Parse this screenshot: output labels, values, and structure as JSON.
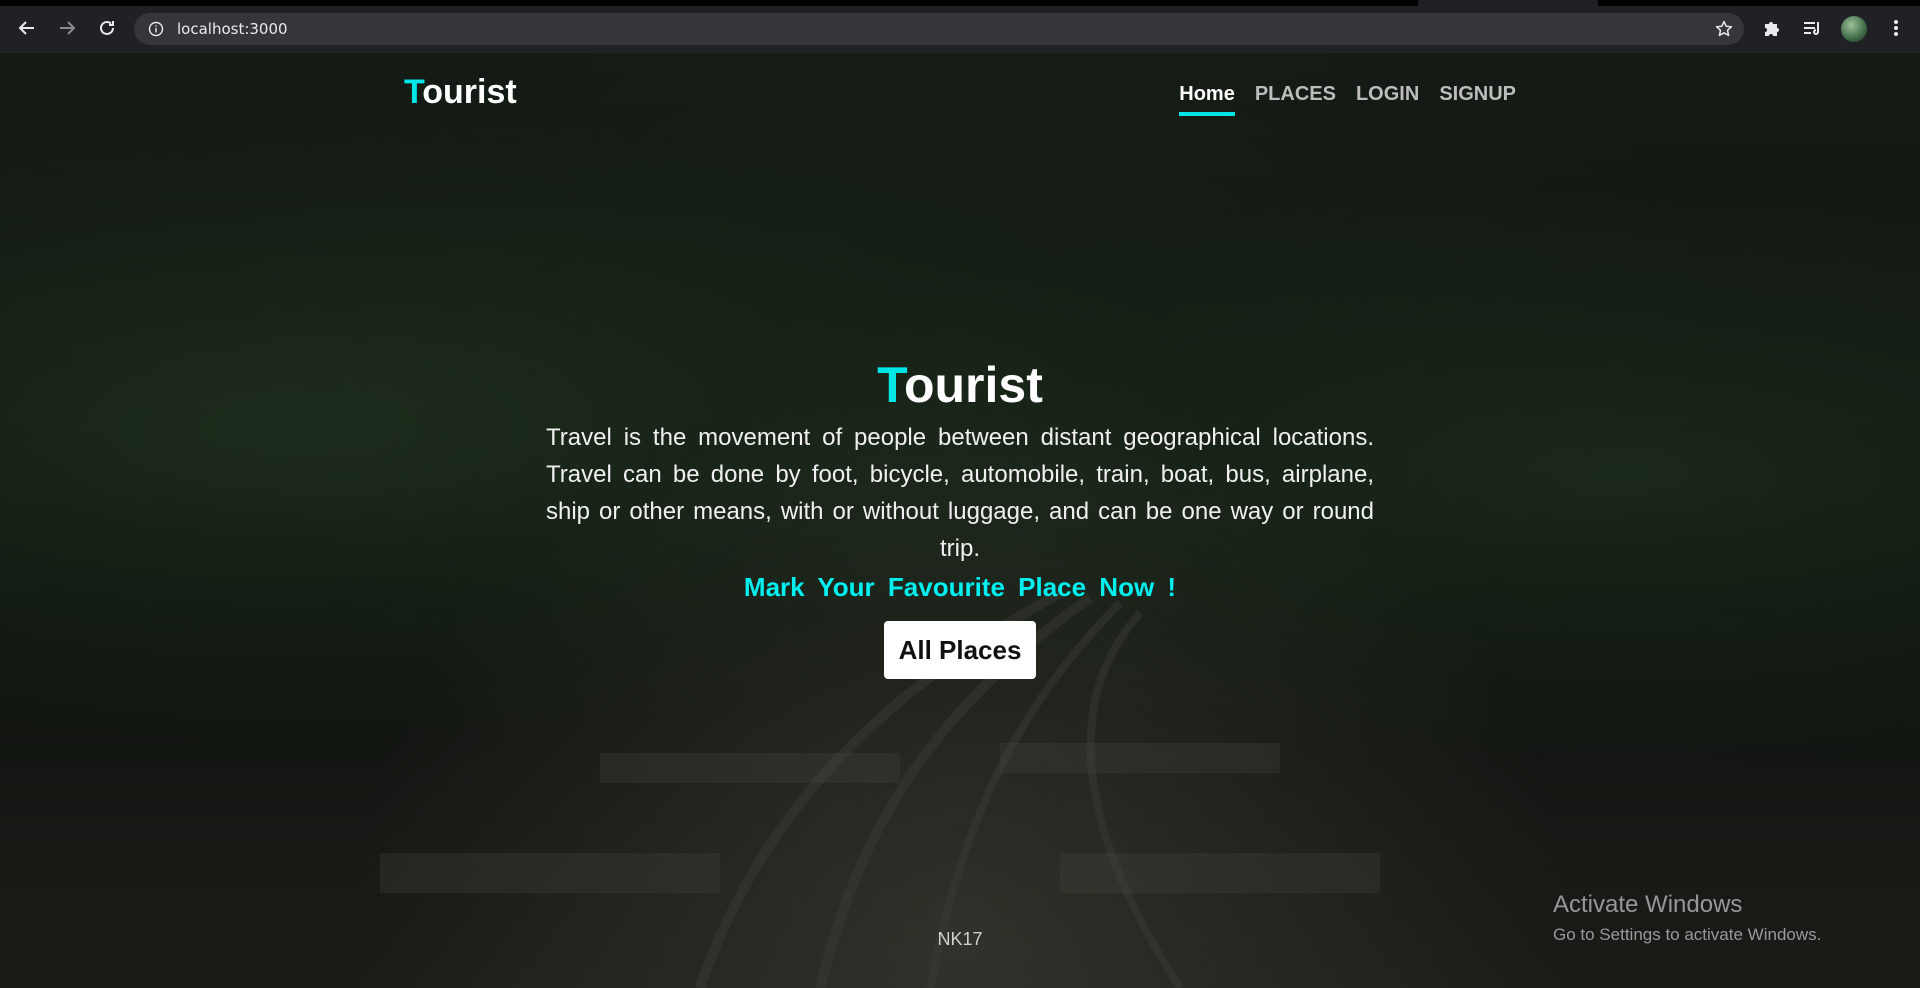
{
  "browser": {
    "url": "localhost:3000",
    "icons": [
      "back-arrow-icon",
      "forward-arrow-icon",
      "reload-icon",
      "site-info-icon",
      "bookmark-star-icon",
      "extensions-puzzle-icon",
      "reading-list-icon",
      "profile-avatar",
      "menu-dots-icon"
    ]
  },
  "navbar": {
    "brand_initial": "T",
    "brand_rest": "ourist",
    "links": [
      {
        "label": "Home",
        "active": true
      },
      {
        "label": "PLACES",
        "active": false
      },
      {
        "label": "LOGIN",
        "active": false
      },
      {
        "label": "SIGNUP",
        "active": false
      }
    ]
  },
  "hero": {
    "title_initial": "T",
    "title_rest": "ourist",
    "description": "Travel is the movement of people between distant geographical locations. Travel can be done by foot, bicycle, automobile, train, boat, bus, airplane, ship or other means, with or without luggage, and can be one way or round trip.",
    "cta_text": "Mark Your Favourite Place Now !",
    "button_label": "All Places"
  },
  "footer": {
    "text": "NK17"
  },
  "watermark": {
    "title": "Activate Windows",
    "subtitle": "Go to Settings to activate Windows."
  },
  "colors": {
    "accent": "#00e5e5",
    "chrome_bg": "#202124",
    "omnibox_bg": "#35363a"
  }
}
